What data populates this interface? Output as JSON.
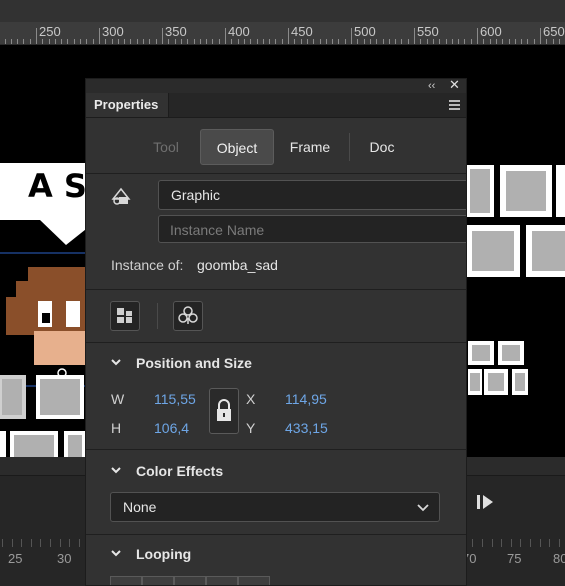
{
  "ruler": {
    "labels": [
      "250",
      "300",
      "350",
      "400",
      "450",
      "500",
      "550",
      "600",
      "650"
    ]
  },
  "timeline": {
    "frame_numbers": [
      "25",
      "30",
      "70",
      "75",
      "80"
    ]
  },
  "properties": {
    "panel_tab": "Properties",
    "mode_tabs": {
      "tool": "Tool",
      "object": "Object",
      "frame": "Frame",
      "doc": "Doc"
    },
    "symbol_type": "Graphic",
    "instance_name_placeholder": "Instance Name",
    "instance_of_label": "Instance of:",
    "instance_of_value": "goomba_sad",
    "position_size": {
      "title": "Position and Size",
      "w_label": "W",
      "w_value": "115,55",
      "h_label": "H",
      "h_value": "106,4",
      "x_label": "X",
      "x_value": "114,95",
      "y_label": "Y",
      "y_value": "433,15"
    },
    "color_effects": {
      "title": "Color Effects",
      "selected": "None"
    },
    "looping": {
      "title": "Looping"
    }
  },
  "colors": {
    "accent_value": "#6ea6e6",
    "panel_bg": "#323232",
    "stage_bg": "#000000"
  }
}
